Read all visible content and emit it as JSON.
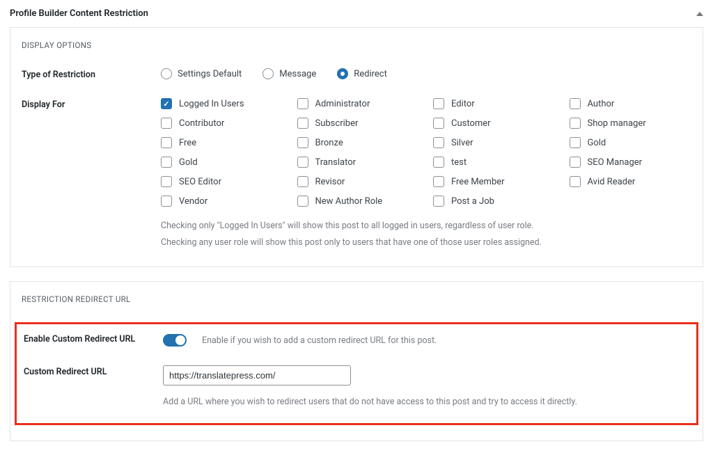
{
  "panel": {
    "title": "Profile Builder Content Restriction"
  },
  "display_options": {
    "section_title": "DISPLAY OPTIONS",
    "type_label": "Type of Restriction",
    "radios": [
      {
        "label": "Settings Default",
        "selected": false
      },
      {
        "label": "Message",
        "selected": false
      },
      {
        "label": "Redirect",
        "selected": true
      }
    ],
    "display_for_label": "Display For",
    "roles": [
      {
        "label": "Logged In Users",
        "checked": true
      },
      {
        "label": "Administrator",
        "checked": false
      },
      {
        "label": "Editor",
        "checked": false
      },
      {
        "label": "Author",
        "checked": false
      },
      {
        "label": "Contributor",
        "checked": false
      },
      {
        "label": "Subscriber",
        "checked": false
      },
      {
        "label": "Customer",
        "checked": false
      },
      {
        "label": "Shop manager",
        "checked": false
      },
      {
        "label": "Free",
        "checked": false
      },
      {
        "label": "Bronze",
        "checked": false
      },
      {
        "label": "Silver",
        "checked": false
      },
      {
        "label": "Gold",
        "checked": false
      },
      {
        "label": "Gold",
        "checked": false
      },
      {
        "label": "Translator",
        "checked": false
      },
      {
        "label": "test",
        "checked": false
      },
      {
        "label": "SEO Manager",
        "checked": false
      },
      {
        "label": "SEO Editor",
        "checked": false
      },
      {
        "label": "Revisor",
        "checked": false
      },
      {
        "label": "Free Member",
        "checked": false
      },
      {
        "label": "Avid Reader",
        "checked": false
      },
      {
        "label": "Vendor",
        "checked": false
      },
      {
        "label": "New Author Role",
        "checked": false
      },
      {
        "label": "Post a Job",
        "checked": false
      }
    ],
    "help1": "Checking only \"Logged In Users\" will show this post to all logged in users, regardless of user role.",
    "help2": "Checking any user role will show this post only to users that have one of those user roles assigned."
  },
  "redirect": {
    "section_title": "RESTRICTION REDIRECT URL",
    "enable_label": "Enable Custom Redirect URL",
    "enable_help": "Enable if you wish to add a custom redirect URL for this post.",
    "url_label": "Custom Redirect URL",
    "url_value": "https://translatepress.com/",
    "url_help": "Add a URL where you wish to redirect users that do not have access to this post and try to access it directly."
  }
}
